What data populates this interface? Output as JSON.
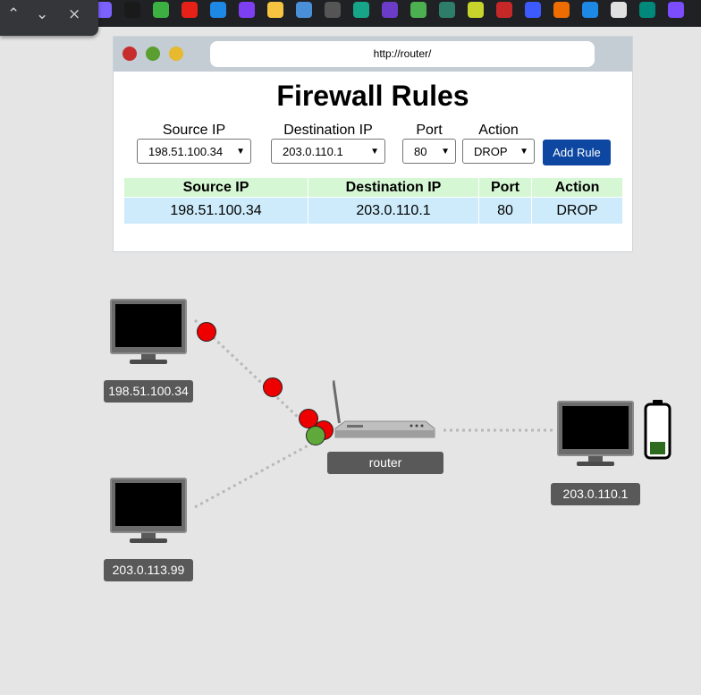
{
  "browser": {
    "download_panel": {
      "collapse_icon": "^",
      "expand_icon": "v",
      "close_icon": "×"
    },
    "extensions": [
      {
        "name": "ext-purple-icon",
        "color": "#7b61ff"
      },
      {
        "name": "ext-arc-icon",
        "color": "#1a1a1a"
      },
      {
        "name": "ext-green-bolt-icon",
        "color": "#3cb043"
      },
      {
        "name": "ext-youtube-icon",
        "color": "#e62117"
      },
      {
        "name": "ext-media-icon",
        "color": "#1e88e5"
      },
      {
        "name": "ext-u-icon",
        "color": "#7e3ff2"
      },
      {
        "name": "ext-cookie-icon",
        "color": "#f5c542"
      },
      {
        "name": "ext-cloud-icon",
        "color": "#4a90d9"
      },
      {
        "name": "ext-doc-icon",
        "color": "#555555"
      },
      {
        "name": "ext-teal-icon",
        "color": "#17a589"
      },
      {
        "name": "ext-h-icon",
        "color": "#6a3cc8"
      },
      {
        "name": "ext-download-icon",
        "color": "#4caf50"
      },
      {
        "name": "ext-eth-icon",
        "color": "#2e7d6b"
      },
      {
        "name": "ext-cube-icon",
        "color": "#c6d42c"
      },
      {
        "name": "ext-red-cloud-icon",
        "color": "#c62828"
      },
      {
        "name": "ext-ar-icon",
        "color": "#3d5afe"
      },
      {
        "name": "ext-orange-icon",
        "color": "#ef6c00"
      },
      {
        "name": "ext-e-icon",
        "color": "#1e88e5"
      },
      {
        "name": "ext-trello-icon",
        "color": "#e0e0e0"
      },
      {
        "name": "ext-chart-icon",
        "color": "#00897b"
      },
      {
        "name": "ext-ghost-icon",
        "color": "#7c4dff"
      }
    ]
  },
  "window": {
    "url": "http://router/",
    "title": "Firewall Rules",
    "form": {
      "source_label": "Source IP",
      "source_value": "198.51.100.34",
      "dest_label": "Destination IP",
      "dest_value": "203.0.110.1",
      "port_label": "Port",
      "port_value": "80",
      "action_label": "Action",
      "action_value": "DROP",
      "add_button": "Add Rule"
    },
    "table": {
      "headers": [
        "Source IP",
        "Destination IP",
        "Port",
        "Action"
      ],
      "rows": [
        [
          "198.51.100.34",
          "203.0.110.1",
          "80",
          "DROP"
        ]
      ]
    }
  },
  "network": {
    "hosts": {
      "host1": "198.51.100.34",
      "host2": "203.0.113.99",
      "server": "203.0.110.1",
      "router": "router"
    },
    "server_battery_level": 0.25,
    "colors": {
      "blocked_packet": "#ee0000",
      "allowed_packet": "#5fa83a",
      "link": "#b8b8b8",
      "add_button": "#0d47a1",
      "header_row": "#d6f7d4",
      "data_row": "#cdebfa"
    }
  }
}
